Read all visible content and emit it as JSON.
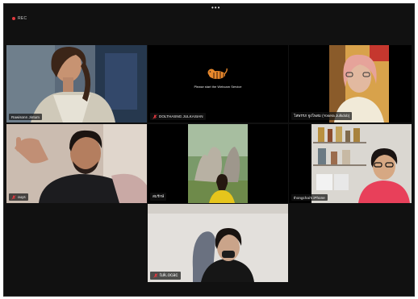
{
  "toolbar": {
    "rec_label": "REC",
    "more_label": "•••"
  },
  "tiles": [
    {
      "name": "Rawisonn Jintum",
      "muted": false
    },
    {
      "name": "DOLTHASNG JULKASIAN",
      "muted": true,
      "message": "Please start the Webcam Service"
    },
    {
      "name": "โสพรรภ จูงโพสม (Yosera Julkdob)",
      "muted": false
    },
    {
      "name": "ouys",
      "muted": true
    },
    {
      "name": "สมรักษ์",
      "muted": false
    },
    {
      "name": "thongchai's iPhone",
      "muted": false
    },
    {
      "name": "tuk.ocac",
      "muted": true
    }
  ],
  "colors": {
    "active_speaker": "#3fd06a",
    "mic_off": "#e0383e",
    "background": "#111111"
  }
}
